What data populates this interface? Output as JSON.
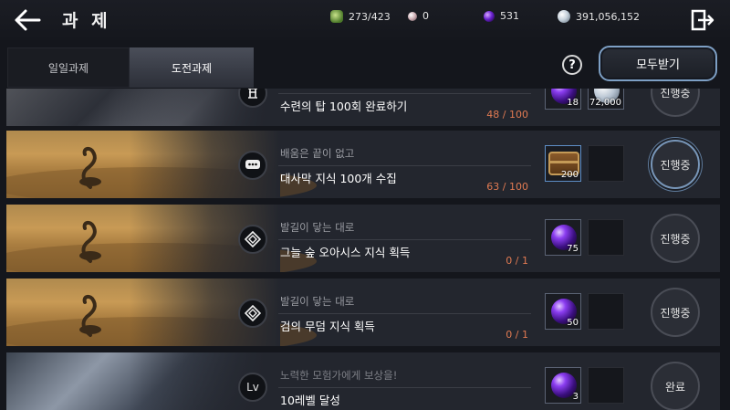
{
  "header": {
    "title": "과 제",
    "currencies": [
      {
        "icon": "energy-icon",
        "value": "273/423"
      },
      {
        "icon": "pearl-icon",
        "value": "0"
      },
      {
        "icon": "purple-orb-icon",
        "value": "531"
      },
      {
        "icon": "silver-coin-icon",
        "value": "391,056,152"
      }
    ]
  },
  "tabs": [
    {
      "label": "일일과제",
      "active": false
    },
    {
      "label": "도전과제",
      "active": true
    }
  ],
  "help_label": "?",
  "claim_all_label": "모두받기",
  "quests": [
    {
      "subtitle": "",
      "title": "수련의 탑 100회 완료하기",
      "progress": "48 / 100",
      "type_icon": "tower-icon",
      "rewards": [
        {
          "icon": "purple-orb-icon",
          "qty": "18"
        },
        {
          "icon": "silver-coin-icon",
          "qty": "72,000"
        }
      ],
      "status": "진행중"
    },
    {
      "subtitle": "배움은 끝이 없고",
      "title": "대사막 지식 100개 수집",
      "progress": "63 / 100",
      "type_icon": "chat-bubble-icon",
      "rewards": [
        {
          "icon": "treasure-chest-icon",
          "qty": "200"
        },
        {
          "icon": "",
          "qty": ""
        }
      ],
      "status": "진행중"
    },
    {
      "subtitle": "발길이 닿는 대로",
      "title": "그늘 숲 오아시스 지식 획득",
      "progress": "0 / 1",
      "type_icon": "diamond-compass-icon",
      "rewards": [
        {
          "icon": "purple-orb-icon",
          "qty": "75"
        },
        {
          "icon": "",
          "qty": ""
        }
      ],
      "status": "진행중"
    },
    {
      "subtitle": "발길이 닿는 대로",
      "title": "검의 무덤 지식 획득",
      "progress": "0 / 1",
      "type_icon": "diamond-compass-icon",
      "rewards": [
        {
          "icon": "purple-orb-icon",
          "qty": "50"
        },
        {
          "icon": "",
          "qty": ""
        }
      ],
      "status": "진행중"
    },
    {
      "subtitle": "노력한 모험가에게 보상을!",
      "title": "10레벨 달성",
      "progress": "",
      "type_icon": "level-icon",
      "type_label": "Lv",
      "rewards": [
        {
          "icon": "purple-orb-icon",
          "qty": "3"
        },
        {
          "icon": "",
          "qty": ""
        }
      ],
      "status": "완료"
    }
  ]
}
